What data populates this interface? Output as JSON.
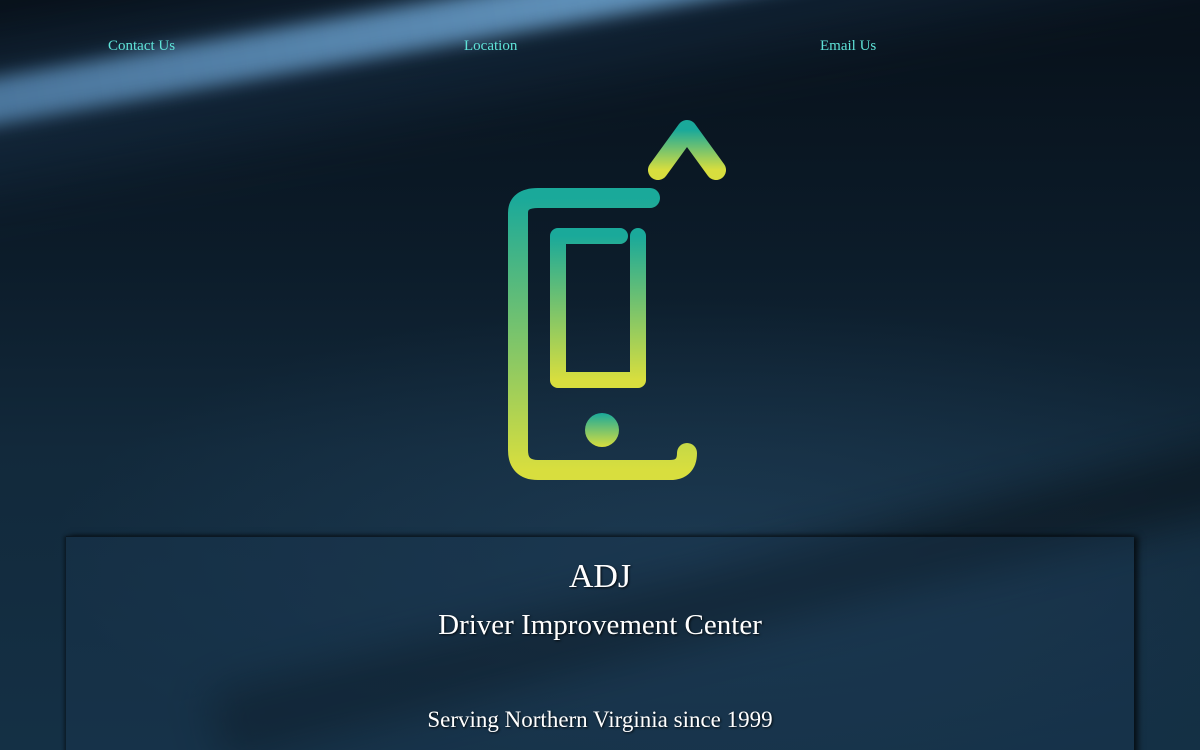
{
  "nav": {
    "items": [
      {
        "label": "Contact Us"
      },
      {
        "label": "Location"
      },
      {
        "label": "Email Us"
      }
    ],
    "link_color": "#5fe3d8"
  },
  "logo": {
    "icon": "phone-with-up-arrow-icon",
    "gradient_top": "#1aa99a",
    "gradient_bottom": "#d8de3e"
  },
  "hero": {
    "title": "ADJ",
    "subtitle": "Driver Improvement Center",
    "tagline": "Serving Northern Virginia since 1999"
  }
}
